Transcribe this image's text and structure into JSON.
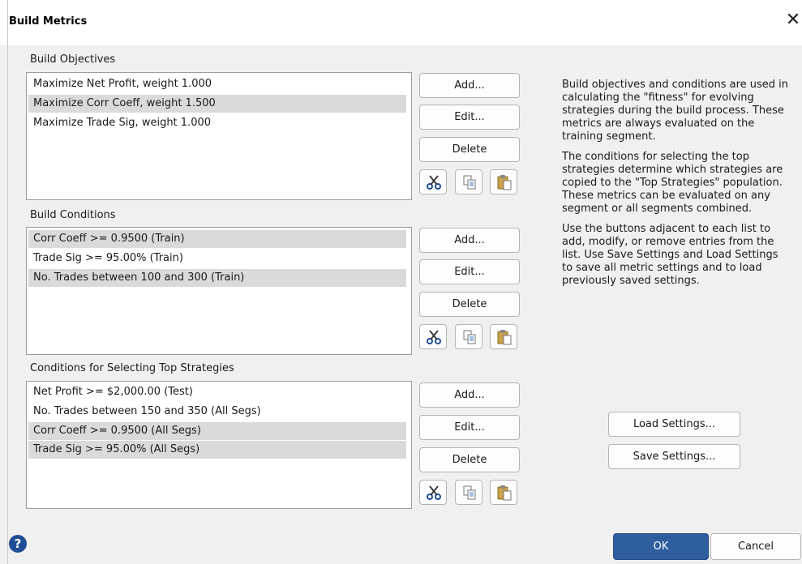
{
  "window": {
    "title": "Build Metrics",
    "close_glyph": "✕"
  },
  "sections": {
    "objectives": {
      "label": "Build Objectives",
      "items": [
        "Maximize Net Profit, weight 1.000",
        "Maximize Corr Coeff, weight 1.500",
        "Maximize Trade Sig, weight 1.000"
      ],
      "selected_rows": [
        1
      ]
    },
    "conditions": {
      "label": "Build Conditions",
      "items": [
        "Corr Coeff >=  0.9500 (Train)",
        "Trade Sig >=  95.00% (Train)",
        "No. Trades between  100 and 300 (Train)"
      ],
      "selected_rows": [
        0,
        2
      ]
    },
    "top": {
      "label": "Conditions for Selecting Top Strategies",
      "items": [
        "Net Profit >=  $2,000.00 (Test)",
        "No. Trades between  150 and 350 (All Segs)",
        "Corr Coeff >=  0.9500 (All Segs)",
        "Trade Sig >=  95.00% (All Segs)"
      ],
      "selected_rows": [
        2,
        3
      ]
    }
  },
  "buttons": {
    "add": "Add...",
    "edit": "Edit...",
    "delete": "Delete",
    "load_settings": "Load Settings...",
    "save_settings": "Save Settings...",
    "ok": "OK",
    "cancel": "Cancel"
  },
  "icons": {
    "cut": "scissors-icon",
    "copy": "copy-icon",
    "paste": "paste-icon",
    "help": "help-icon",
    "help_glyph": "?"
  },
  "help_text": {
    "p1": "Build objectives and conditions are used in calculating the \"fitness\" for evolving strategies during the build process. These metrics are always evaluated on the training segment.",
    "p2": "The conditions for selecting the top strategies determine which strategies are copied to the \"Top Strategies\" population. These metrics can be evaluated on any segment or all segments combined.",
    "p3": "Use the buttons adjacent to each list to add, modify, or remove entries from the list. Use Save Settings and Load Settings to save all metric settings and to load previously saved settings."
  },
  "colors": {
    "accent": "#2e5e9e",
    "selection": "#dadada",
    "background": "#f0f0f0"
  }
}
